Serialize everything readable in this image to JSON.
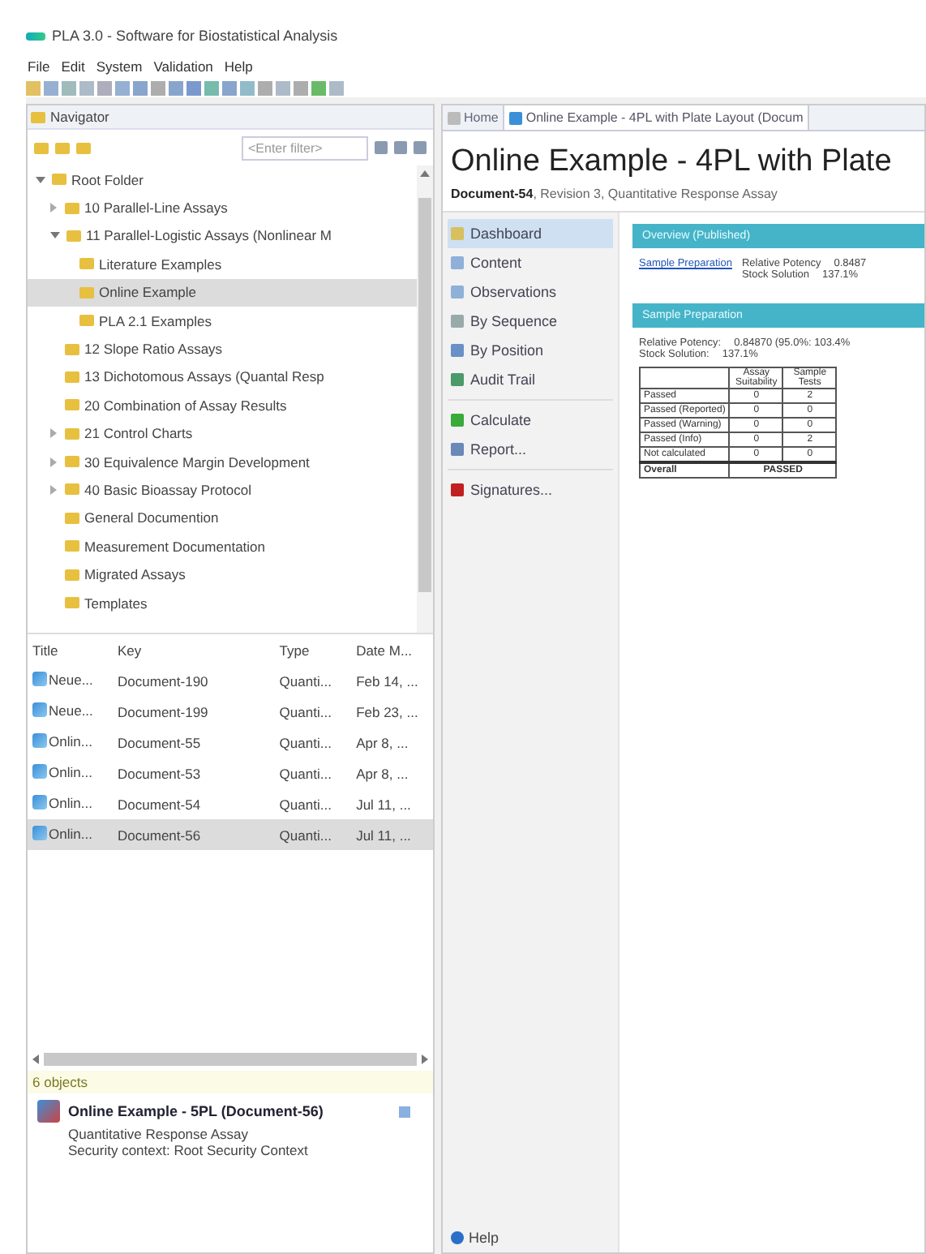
{
  "window": {
    "title": "PLA 3.0 - Software for Biostatistical Analysis"
  },
  "menu": [
    "File",
    "Edit",
    "System",
    "Validation",
    "Help"
  ],
  "navigator": {
    "title": "Navigator",
    "filter": {
      "placeholder": "<Enter filter>"
    },
    "tree": [
      {
        "label": "Root Folder",
        "expanded": true,
        "selected": false,
        "children": [
          {
            "label": "10 Parallel-Line Assays",
            "expanded": false,
            "selected": false
          },
          {
            "label": "11 Parallel-Logistic Assays (Nonlinear M",
            "expanded": true,
            "selected": false,
            "children": [
              {
                "label": "Literature Examples",
                "selected": false
              },
              {
                "label": "Online Example",
                "selected": true
              },
              {
                "label": "PLA 2.1 Examples",
                "selected": false
              }
            ]
          },
          {
            "label": "12 Slope Ratio Assays",
            "selected": false
          },
          {
            "label": "13 Dichotomous Assays (Quantal Resp",
            "selected": false
          },
          {
            "label": "20 Combination of Assay Results",
            "selected": false
          },
          {
            "label": "21 Control Charts",
            "expanded": false,
            "selected": false
          },
          {
            "label": "30 Equivalence Margin Development",
            "expanded": false,
            "selected": false
          },
          {
            "label": "40 Basic Bioassay Protocol",
            "expanded": false,
            "selected": false
          },
          {
            "label": "General Documention",
            "selected": false
          },
          {
            "label": "Measurement Documentation",
            "selected": false
          },
          {
            "label": "Migrated Assays",
            "selected": false
          },
          {
            "label": "Templates",
            "selected": false
          }
        ]
      }
    ]
  },
  "documents": {
    "columns": [
      "Title",
      "Key",
      "Type",
      "Date M..."
    ],
    "rows": [
      {
        "cells": [
          "Neue...",
          "Document-190",
          "Quanti...",
          "Feb 14, ..."
        ],
        "selected": false
      },
      {
        "cells": [
          "Neue...",
          "Document-199",
          "Quanti...",
          "Feb 23, ..."
        ],
        "selected": false
      },
      {
        "cells": [
          "Onlin...",
          "Document-55",
          "Quanti...",
          "Apr 8, ..."
        ],
        "selected": false
      },
      {
        "cells": [
          "Onlin...",
          "Document-53",
          "Quanti...",
          "Apr 8, ..."
        ],
        "selected": false
      },
      {
        "cells": [
          "Onlin...",
          "Document-54",
          "Quanti...",
          "Jul 11, ..."
        ],
        "selected": false
      },
      {
        "cells": [
          "Onlin...",
          "Document-56",
          "Quanti...",
          "Jul 11, ..."
        ],
        "selected": true
      }
    ],
    "count": "6 objects"
  },
  "details": {
    "title": "Online Example - 5PL (Document-56)",
    "lines": [
      "Quantitative Response Assay",
      "Security context: Root Security Context"
    ]
  },
  "editor": {
    "tabs": [
      {
        "label": "Home",
        "selected": false
      },
      {
        "label": "Online Example - 4PL with Plate Layout (Docum",
        "selected": true
      }
    ],
    "heading": "Online Example - 4PL with Plate",
    "subtitle": "**Document-54**, Revision 3, Quantitative Response Assay",
    "nav": [
      [
        {
          "label": "Dashboard",
          "selected": true
        },
        {
          "label": "Content",
          "selected": false
        },
        {
          "label": "Observations",
          "selected": false
        },
        {
          "label": "By Sequence",
          "selected": false
        },
        {
          "label": "By Position",
          "selected": false
        },
        {
          "label": "Audit Trail",
          "selected": false
        }
      ],
      [
        {
          "label": "Calculate",
          "selected": false
        },
        {
          "label": "Report...",
          "selected": false
        }
      ],
      [
        {
          "label": "Signatures...",
          "selected": false
        }
      ]
    ],
    "help": "Help",
    "sections": [
      {
        "title": "Overview (Published)",
        "link": "Sample Preparation",
        "lines": [
          [
            "Relative Potency",
            "0.8487"
          ],
          [
            "Stock Solution",
            "137.1%"
          ]
        ]
      },
      {
        "title": "Sample Preparation",
        "lines": [
          [
            "Relative Potency:",
            "0.84870  (95.0%: 103.4%"
          ],
          [
            "Stock Solution:",
            "137.1%"
          ]
        ],
        "table": {
          "columns": [
            "",
            "Assay Suitability",
            "Sample Tests"
          ],
          "rows": [
            [
              "Passed",
              "0",
              "2"
            ],
            [
              "Passed (Reported)",
              "0",
              "0"
            ],
            [
              "Passed (Warning)",
              "0",
              "0"
            ],
            [
              "Passed (Info)",
              "0",
              "2"
            ],
            [
              "Not calculated",
              "0",
              "0"
            ]
          ],
          "overall": [
            "Overall",
            "PASSED"
          ]
        }
      }
    ]
  }
}
